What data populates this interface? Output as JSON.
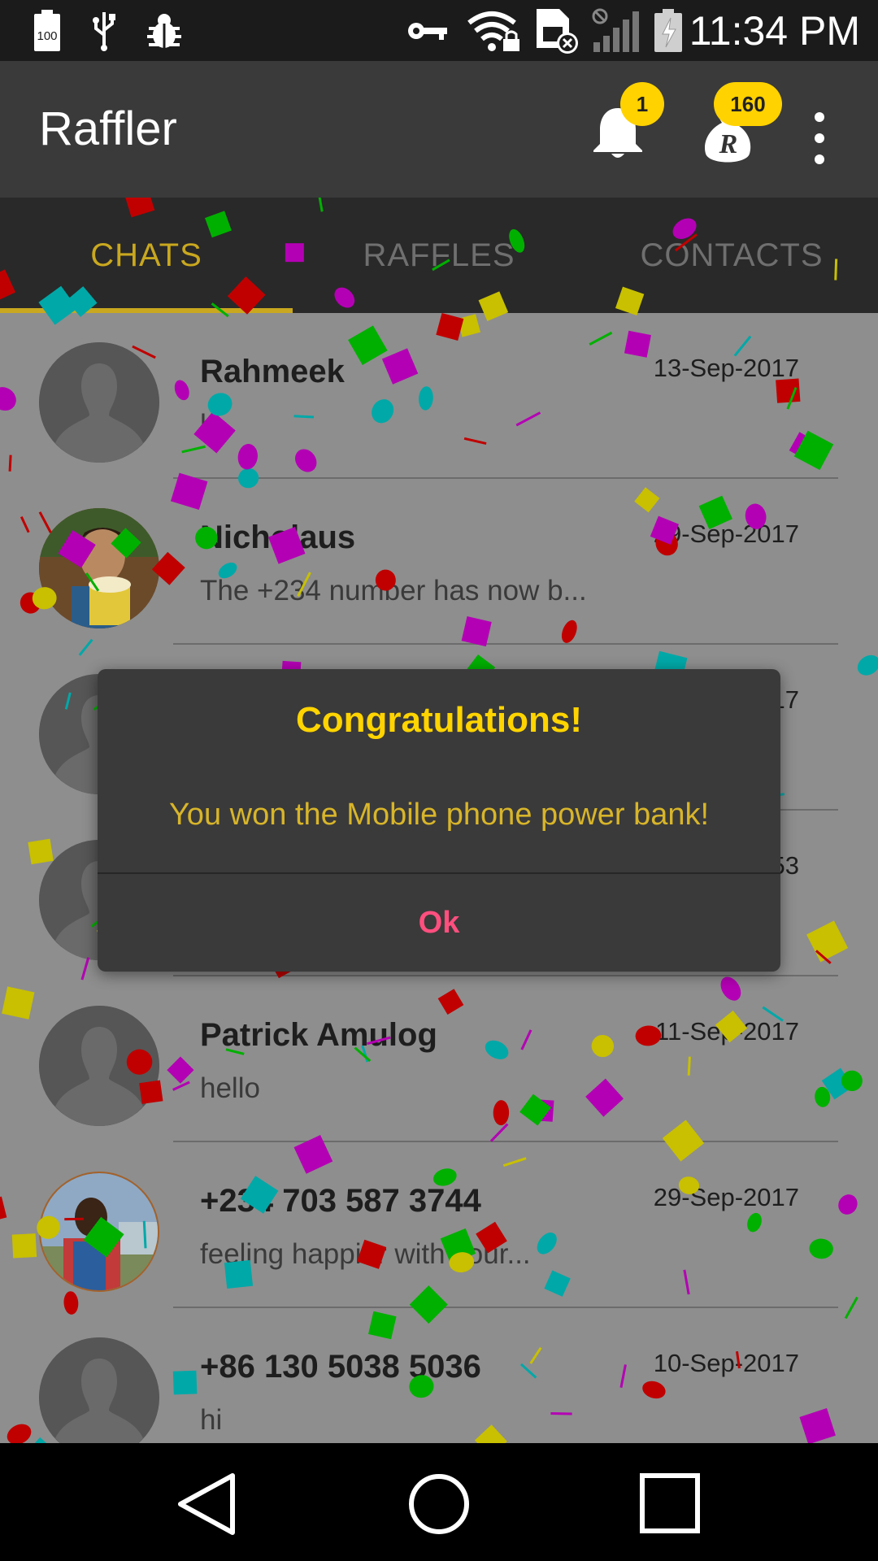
{
  "status_bar": {
    "time": "11:34 PM",
    "battery_level": "100",
    "icons": [
      "battery-icon",
      "usb-icon",
      "bug-icon",
      "key-icon",
      "wifi-lock-icon",
      "sim-off-icon",
      "signal-off-icon",
      "charging-icon"
    ]
  },
  "app_bar": {
    "title": "Raffler",
    "notification_count": "1",
    "coins_count": "160",
    "coin_letter": "R"
  },
  "tabs": [
    {
      "label": "CHATS",
      "active": true
    },
    {
      "label": "RAFFLES",
      "active": false
    },
    {
      "label": "CONTACTS",
      "active": false
    }
  ],
  "chats": [
    {
      "name": "Rahmeek",
      "date": "13-Sep-2017",
      "message": "hi",
      "avatar": "default"
    },
    {
      "name": "Nicholaus",
      "date": "29-Sep-2017",
      "message": "The +234 number has now b...",
      "avatar": "photo"
    },
    {
      "name": "",
      "date": "...17",
      "message": "",
      "avatar": "default"
    },
    {
      "name": "",
      "date": "...53",
      "message": "",
      "avatar": "default"
    },
    {
      "name": "Patrick Amulog",
      "date": "11-Sep-2017",
      "message": "hello",
      "avatar": "default"
    },
    {
      "name": "+234 703 587 3744",
      "date": "29-Sep-2017",
      "message": "feeling happier with your...",
      "avatar": "photo"
    },
    {
      "name": "+86 130 5038 5036",
      "date": "10-Sep-2017",
      "message": "hi",
      "avatar": "default"
    }
  ],
  "dialog": {
    "title": "Congratulations!",
    "message": "You won the Mobile phone power bank!",
    "ok_label": "Ok"
  },
  "colors": {
    "accent": "#ffd200",
    "tab_active": "#c9a81f",
    "ok_button": "#ff4f7f",
    "confetti": [
      "#c00000",
      "#b400b4",
      "#00a8a8",
      "#00b000",
      "#c8c000"
    ]
  },
  "nav_bar": {
    "icons": [
      "back-icon",
      "home-icon",
      "recents-icon"
    ]
  }
}
